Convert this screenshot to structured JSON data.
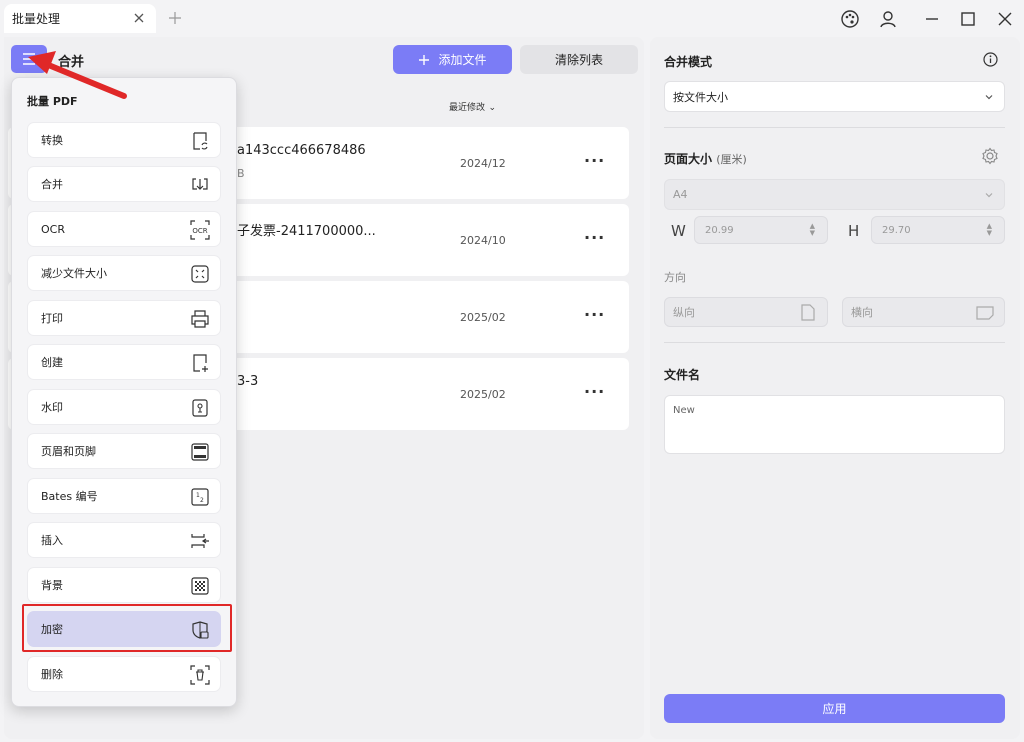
{
  "tab": {
    "title": "批量处理"
  },
  "main": {
    "title": "合并",
    "add_button": "添加文件",
    "clear_button": "清除列表",
    "sort_label": "最近修改",
    "files": [
      {
        "name": "a143ccc466678486",
        "sub": "B",
        "date": "2024/12"
      },
      {
        "name": "子发票-2411700000...",
        "sub": "",
        "date": "2024/10"
      },
      {
        "name": "",
        "sub": "",
        "date": "2025/02"
      },
      {
        "name": "3-3",
        "sub": "",
        "date": "2025/02"
      }
    ]
  },
  "menu": {
    "title": "批量 PDF",
    "items": [
      {
        "label": "转换",
        "icon": "convert-icon"
      },
      {
        "label": "合并",
        "icon": "merge-icon"
      },
      {
        "label": "OCR",
        "icon": "ocr-icon"
      },
      {
        "label": "减少文件大小",
        "icon": "compress-icon"
      },
      {
        "label": "打印",
        "icon": "printer-icon"
      },
      {
        "label": "创建",
        "icon": "create-icon"
      },
      {
        "label": "水印",
        "icon": "watermark-icon"
      },
      {
        "label": "页眉和页脚",
        "icon": "header-footer-icon"
      },
      {
        "label": "Bates 编号",
        "icon": "bates-icon"
      },
      {
        "label": "插入",
        "icon": "insert-icon"
      },
      {
        "label": "背景",
        "icon": "background-icon"
      },
      {
        "label": "加密",
        "icon": "encrypt-icon"
      },
      {
        "label": "删除",
        "icon": "delete-icon"
      }
    ],
    "selected": "加密"
  },
  "right": {
    "merge_mode_label": "合并模式",
    "merge_mode_value": "按文件大小",
    "page_size_label": "页面大小",
    "page_size_unit": "(厘米)",
    "page_size_value": "A4",
    "w_label": "W",
    "w_value": "20.99",
    "h_label": "H",
    "h_value": "29.70",
    "orientation_label": "方向",
    "portrait": "纵向",
    "landscape": "横向",
    "filename_label": "文件名",
    "filename_value": "New",
    "apply_button": "应用"
  },
  "colors": {
    "accent": "#7b7cf6",
    "highlight": "#e02828"
  }
}
